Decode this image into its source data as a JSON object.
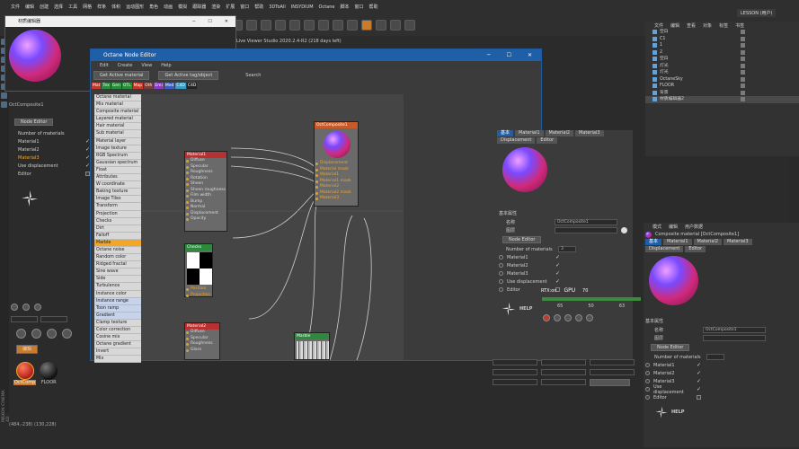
{
  "menu": {
    "items": [
      "文件",
      "编辑",
      "创建",
      "选择",
      "工具",
      "网格",
      "样条",
      "体积",
      "运动图形",
      "角色",
      "动画",
      "模拟",
      "跟踪器",
      "渲染",
      "扩展",
      "窗口",
      "帮助",
      "3DToAll",
      "INSYDIUM",
      "Octane",
      "脚本",
      "窗口",
      "帮助"
    ]
  },
  "layout": {
    "label": "LESSON (用户)"
  },
  "viewer": {
    "title": "材质编辑器",
    "status": "Live Viewer Studio 2020.2.4-R2 (218 days left)"
  },
  "material_left": {
    "name": "OctComposite1",
    "node_editor_btn": "Node Editor",
    "number_label": "Number of materials",
    "rows": [
      "Material1",
      "Material2",
      "Material3",
      "Use displacement",
      "Editor"
    ]
  },
  "node_editor": {
    "title": "Octane Node Editor",
    "menu": [
      "Edit",
      "Create",
      "View",
      "Help"
    ],
    "btn_get_material": "Get Active material",
    "btn_get_tag": "Get Active tag/object",
    "search": "Search",
    "tabs": [
      "Mat",
      "Tex",
      "Gen",
      "OTL",
      "Map",
      "Oth",
      "Emi",
      "Med",
      "C4D",
      "C4D"
    ],
    "list": [
      "Octane material",
      "Mix material",
      "Composite material",
      "Layered material",
      "Hair material",
      "Sub material",
      "Material layer",
      "Image texture",
      "RGB Spectrum",
      "Gaussian spectrum",
      "Float",
      "Attributes",
      "W coordinate",
      "Baking texture",
      "Image Tiles",
      "Transform",
      "Projection",
      "Checks",
      "Dirt",
      "Falloff",
      "Marble",
      "Octane noise",
      "Random color",
      "Ridged fractal",
      "Sine wave",
      "Side",
      "Turbulence",
      "Instance color",
      "Instance range",
      "Toon ramp",
      "Gradient",
      "Clamp texture",
      "Color correction",
      "Cosine mix",
      "Octane gradient",
      "Invert",
      "Mix"
    ],
    "nodes": {
      "material1": {
        "title": "Material1",
        "pins": [
          "Diffuse",
          "Specular",
          "Roughness",
          "Rotation",
          "Sheen",
          "Sheen roughness",
          "Film width",
          "Bump",
          "Normal",
          "Displacement",
          "Opacity"
        ]
      },
      "composite": {
        "title": "OctComposite1",
        "pins": [
          "Displacement",
          "Material mask",
          "Material1",
          "Material1 mask",
          "Material2",
          "Material2 mask",
          "Material3"
        ]
      },
      "checker": {
        "title": "Checks"
      },
      "falloff_lbl": [
        "Position",
        "Projection"
      ],
      "material2": {
        "title": "Material2",
        "pins": [
          "Diffuse",
          "Specular",
          "Roughness",
          "Gloss"
        ]
      },
      "noise": {
        "title": "Marble"
      }
    },
    "panel": {
      "tabs": [
        "基本",
        "Material1",
        "Material2",
        "Material3"
      ],
      "subtabs": [
        "Displacement",
        "Editor"
      ],
      "section": "基本属性",
      "name_label": "名称",
      "name_value": "OctComposite1",
      "layer_label": "图层",
      "node_editor_btn": "Node Editor",
      "number_label": "Number of materials",
      "number_value": "3",
      "rows": [
        "Material1",
        "Material2",
        "Material3",
        "Use displacement",
        "Editor"
      ],
      "help": "HELP"
    }
  },
  "render": {
    "gpu_label": "GPU",
    "gpu_value": "70",
    "rtx": "RTX:on",
    "vals": [
      "65",
      "50",
      "63"
    ]
  },
  "objects": {
    "header": [
      "文件",
      "编辑",
      "查看",
      "对象",
      "标签",
      "书签"
    ],
    "rows": [
      "空白",
      "C1",
      "1",
      "2",
      "空白",
      "灯光",
      "灯光",
      "OctaneSky",
      "FLOOR",
      "背景",
      "材质编辑器2"
    ]
  },
  "attributes": {
    "header": [
      "模式",
      "编辑",
      "用户数据"
    ],
    "title": "Composite material [OctComposite1]",
    "tabs": [
      "基本",
      "Material1",
      "Material2",
      "Material3"
    ],
    "subtabs": [
      "Displacement",
      "Editor"
    ],
    "section": "基本属性",
    "name_label": "名称",
    "name_value": "OctComposite1",
    "layer_label": "图层",
    "node_editor_btn": "Node Editor",
    "number_label": "Number of materials",
    "rows": [
      "Material1",
      "Material2",
      "Material3",
      "Use displacement",
      "Editor"
    ],
    "help": "HELP"
  },
  "materials": {
    "swatches": [
      "OctComp",
      "FLOOR"
    ],
    "label_top": "编辑"
  },
  "status": "(484,-238) (130,228)",
  "brand": "MAXON CINEMA 4D"
}
